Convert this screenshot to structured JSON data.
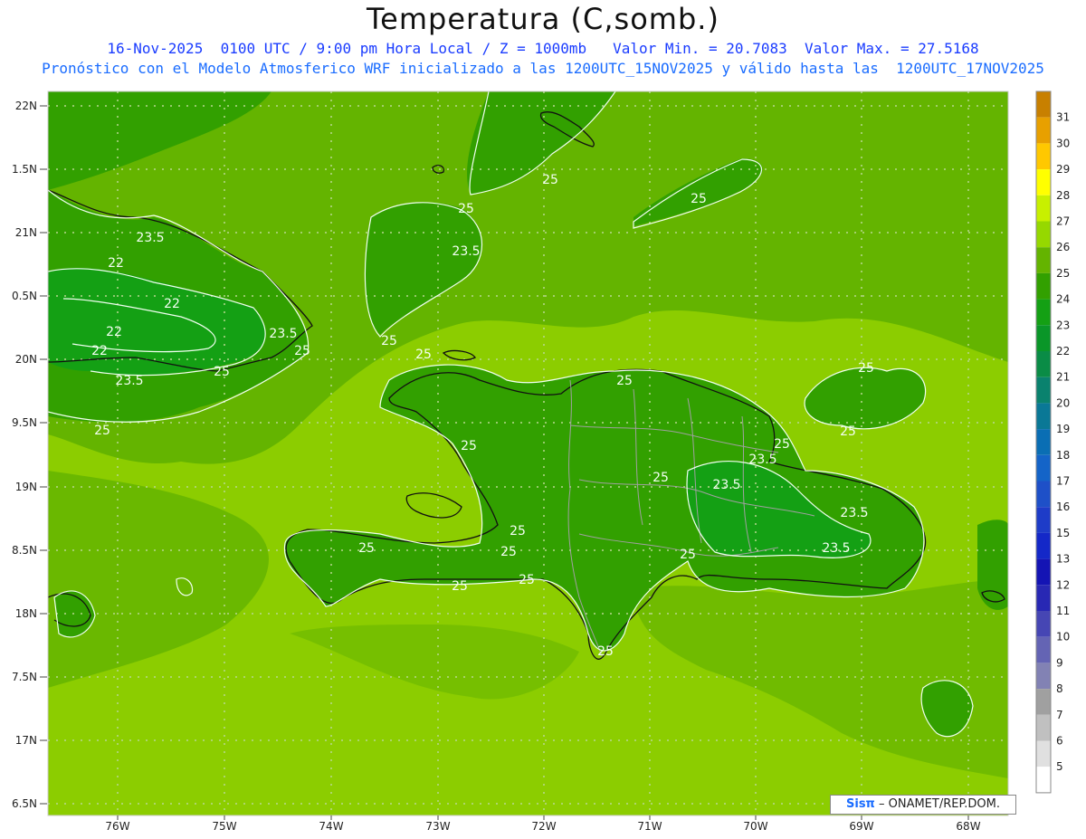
{
  "header": {
    "title": "Temperatura (C,somb.)",
    "line1": "16-Nov-2025  0100 UTC / 9:00 pm Hora Local / Z = 1000mb   Valor Min. = 20.7083  Valor Max. = 27.5168",
    "line2": "Pronóstico con el Modelo Atmosferico WRF inicializado a las 1200UTC_15NOV2025 y válido hasta las  1200UTC_17NOV2025"
  },
  "axes": {
    "lon_labels": [
      "76W",
      "75W",
      "74W",
      "73W",
      "72W",
      "71W",
      "70W",
      "69W",
      "68W"
    ],
    "lat_labels": [
      "22N",
      "1.5N",
      "21N",
      "0.5N",
      "20N",
      "9.5N",
      "19N",
      "8.5N",
      "18N",
      "7.5N",
      "17N",
      "6.5N"
    ]
  },
  "colorbar": {
    "labels": [
      "31",
      "30",
      "29",
      "28",
      "27",
      "26",
      "25",
      "24",
      "23",
      "22",
      "21",
      "20",
      "19",
      "18",
      "17",
      "16",
      "15",
      "13",
      "12",
      "11",
      "10",
      "9",
      "8",
      "7",
      "6",
      "5"
    ],
    "colors": [
      "#c88000",
      "#e8a000",
      "#ffc800",
      "#ffff00",
      "#c8f000",
      "#96d800",
      "#64b400",
      "#32a000",
      "#14a014",
      "#0a9628",
      "#0a8c46",
      "#0a826e",
      "#0a7896",
      "#0a6eb4",
      "#1464c8",
      "#1e50c8",
      "#1e3cc8",
      "#1428c8",
      "#1414b4",
      "#2828b4",
      "#4646b4",
      "#6464b4",
      "#8282b4",
      "#a0a0a0",
      "#c0c0c0",
      "#e0e0e0",
      "#ffffff"
    ]
  },
  "contour_labels": [
    "25",
    "25",
    "23.5",
    "23.5",
    "22",
    "22",
    "22",
    "22",
    "23.5",
    "25",
    "25",
    "25",
    "23.5",
    "25",
    "25",
    "25",
    "25",
    "25",
    "23.5",
    "23.5",
    "23.5",
    "23.5",
    "25",
    "25",
    "25",
    "25",
    "25",
    "25",
    "25",
    "25",
    "25",
    "25",
    "25"
  ],
  "credit": {
    "brand": "Sisπ",
    "text": " – ONAMET/REP.DOM."
  }
}
